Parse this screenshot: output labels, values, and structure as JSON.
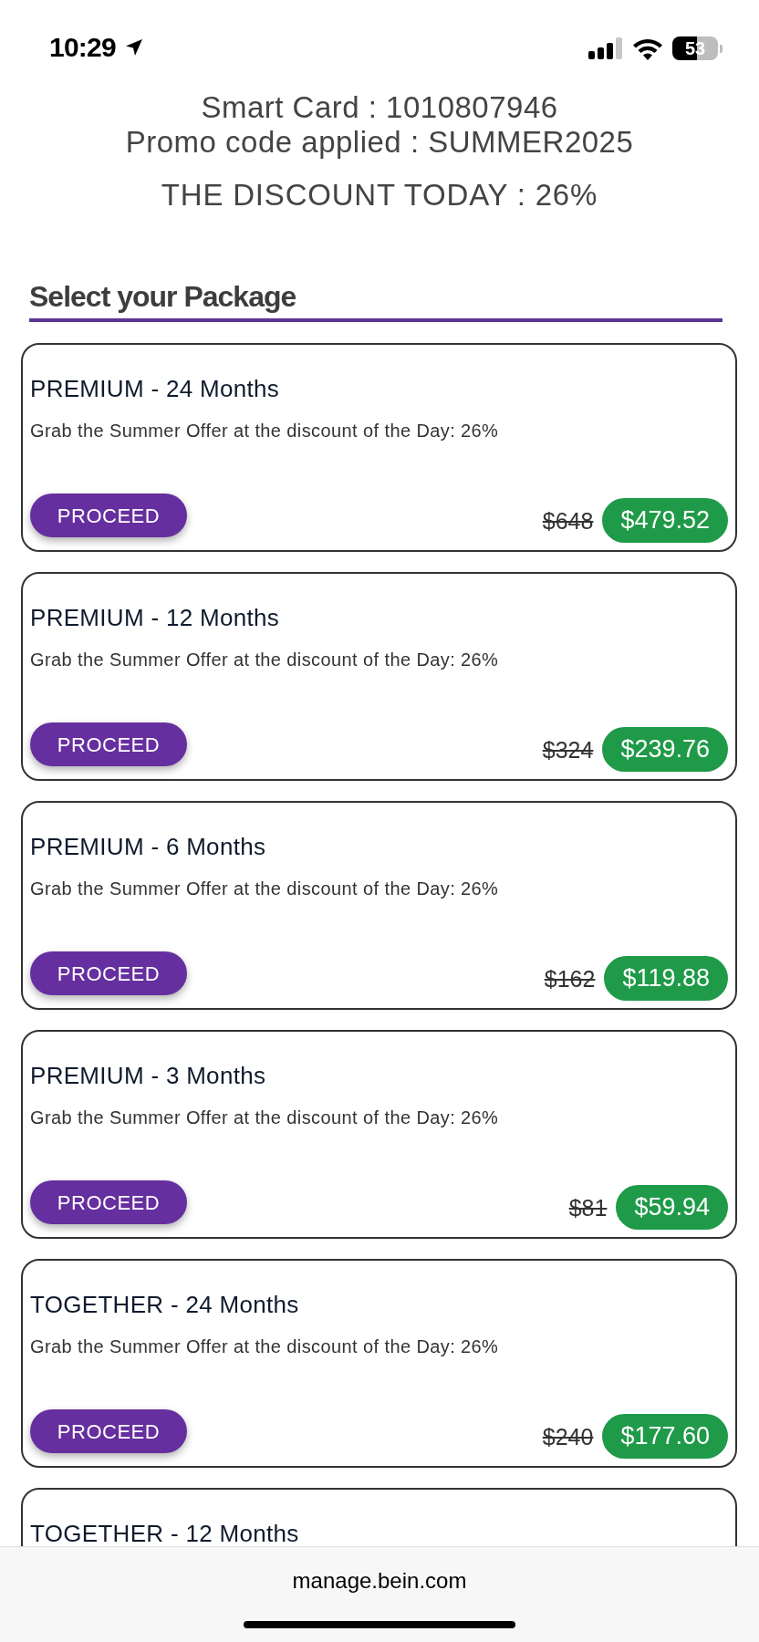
{
  "status_bar": {
    "time": "10:29",
    "battery": "53"
  },
  "header": {
    "smart_card": "Smart Card : 1010807946",
    "promo": "Promo code applied : SUMMER2025",
    "discount": "THE DISCOUNT TODAY : 26%"
  },
  "section_title": "Select your Package",
  "packages": [
    {
      "title": "PREMIUM - 24 Months",
      "description": "Grab the Summer Offer at the discount of the Day: 26%",
      "button": "PROCEED",
      "old_price": "$648",
      "price": "$479.52"
    },
    {
      "title": "PREMIUM - 12 Months",
      "description": "Grab the Summer Offer at the discount of the Day: 26%",
      "button": "PROCEED",
      "old_price": "$324",
      "price": "$239.76"
    },
    {
      "title": "PREMIUM - 6 Months",
      "description": "Grab the Summer Offer at the discount of the Day: 26%",
      "button": "PROCEED",
      "old_price": "$162",
      "price": "$119.88"
    },
    {
      "title": "PREMIUM - 3 Months",
      "description": "Grab the Summer Offer at the discount of the Day: 26%",
      "button": "PROCEED",
      "old_price": "$81",
      "price": "$59.94"
    },
    {
      "title": "TOGETHER - 24 Months",
      "description": "Grab the Summer Offer at the discount of the Day: 26%",
      "button": "PROCEED",
      "old_price": "$240",
      "price": "$177.60"
    },
    {
      "title": "TOGETHER - 12 Months"
    }
  ],
  "browser_bar": {
    "url": "manage.bein.com"
  }
}
